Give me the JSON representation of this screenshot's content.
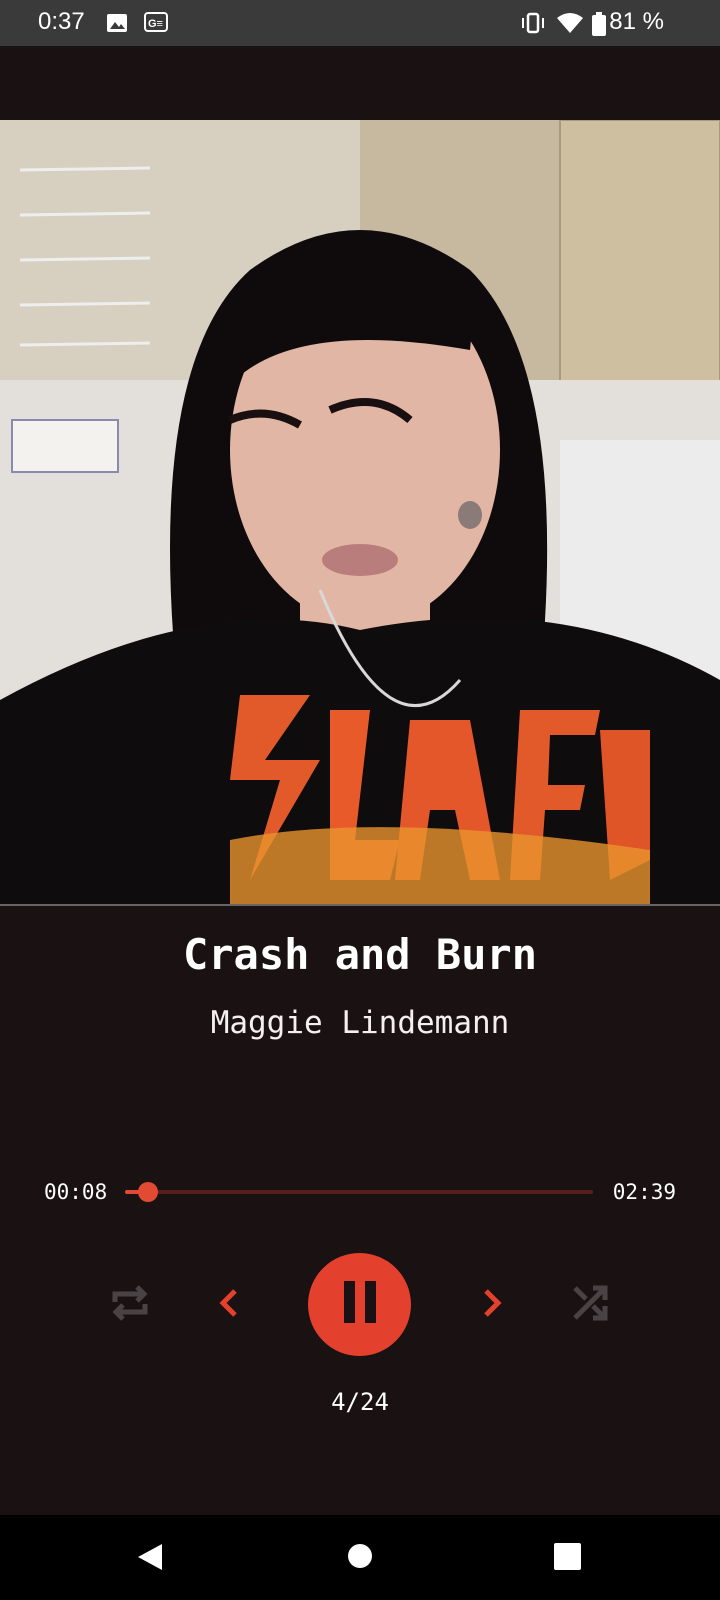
{
  "status_bar": {
    "time": "0:37",
    "battery": "81 %",
    "icons": [
      "image-icon",
      "ge-icon",
      "vibrate-icon",
      "wifi-icon",
      "battery-icon"
    ]
  },
  "player": {
    "title": "Crash and Burn",
    "artist": "Maggie Lindemann",
    "elapsed": "00:08",
    "total": "02:39",
    "progress_fraction": 0.05,
    "queue_position": "4/24",
    "state": "playing"
  },
  "colors": {
    "background": "#1a1113",
    "accent": "#e3402d",
    "disabled": "#4a4346"
  },
  "controls": [
    "repeat-icon",
    "previous-icon",
    "pause-icon",
    "next-icon",
    "shuffle-icon"
  ],
  "nav": [
    "back-icon",
    "home-icon",
    "recents-icon"
  ]
}
